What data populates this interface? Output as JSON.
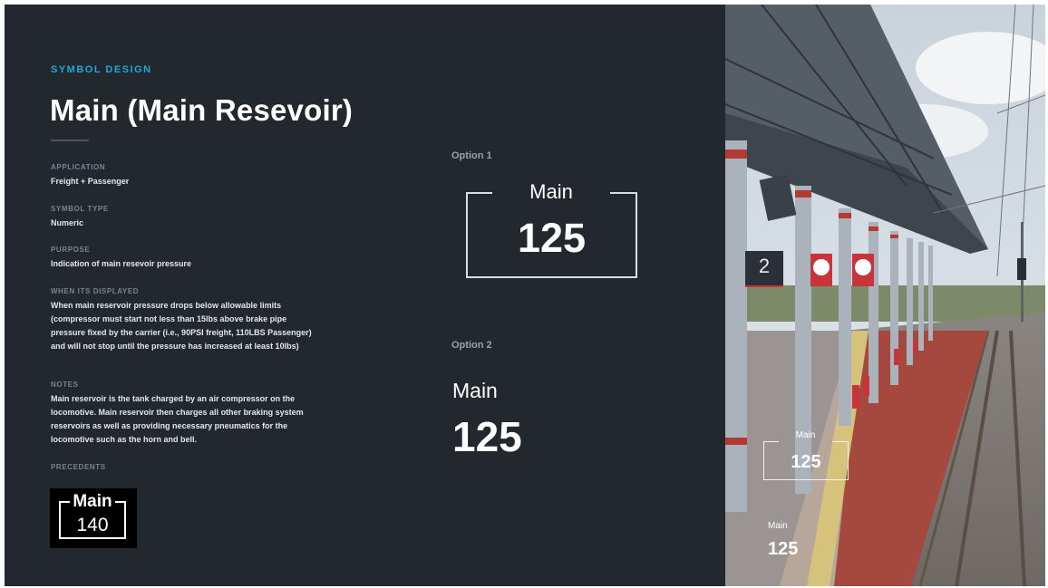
{
  "colors": {
    "panel_bg": "#23282e",
    "accent": "#1fa9d8",
    "muted_label": "#7b838c",
    "text": "#ffffff"
  },
  "header": {
    "eyebrow": "SYMBOL DESIGN",
    "title": "Main (Main Resevoir)"
  },
  "details": {
    "application_label": "APPLICATION",
    "application_value": "Freight + Passenger",
    "symbol_type_label": "SYMBOL TYPE",
    "symbol_type_value": "Numeric",
    "purpose_label": "PURPOSE",
    "purpose_value": "Indication of main resevoir pressure",
    "when_label": "WHEN ITS DISPLAYED",
    "when_value": "When main reservoir pressure drops below allowable limits (compressor must start not less than 15lbs above brake pipe pressure fixed by the carrier (i.e., 90PSI freight, 110LBS Passenger) and will not stop until the pressure has increased at least 10lbs)",
    "notes_label": "NOTES",
    "notes_value": "Main reservoir is the tank charged by an air compressor on the locomotive. Main reservoir then charges all other braking system reservoirs as well as providing necessary pneumatics for the locomotive such as the horn and bell.",
    "precedents_label": "PRECEDENTS"
  },
  "precedent": {
    "label": "Main",
    "value": "140"
  },
  "option1": {
    "heading": "Option 1",
    "label": "Main",
    "value": "125"
  },
  "option2": {
    "heading": "Option 2",
    "label": "Main",
    "value": "125"
  },
  "photo": {
    "platform_number": "2",
    "overlay1_label": "Main",
    "overlay1_value": "125",
    "overlay2_label": "Main",
    "overlay2_value": "125"
  }
}
